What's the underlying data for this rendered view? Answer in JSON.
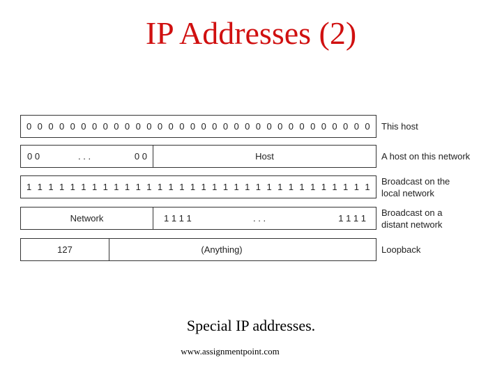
{
  "title": "IP Addresses (2)",
  "rows": [
    {
      "kind": "bits",
      "bits": [
        "0",
        "0",
        "0",
        "0",
        "0",
        "0",
        "0",
        "0",
        "0",
        "0",
        "0",
        "0",
        "0",
        "0",
        "0",
        "0",
        "0",
        "0",
        "0",
        "0",
        "0",
        "0",
        "0",
        "0",
        "0",
        "0",
        "0",
        "0",
        "0",
        "0",
        "0",
        "0"
      ],
      "description": "This host"
    },
    {
      "kind": "split",
      "left": {
        "start": "0 0",
        "ellipsis": ". . .",
        "end": "0 0"
      },
      "right": {
        "label": "Host"
      },
      "description": "A host on this network"
    },
    {
      "kind": "bits",
      "bits": [
        "1",
        "1",
        "1",
        "1",
        "1",
        "1",
        "1",
        "1",
        "1",
        "1",
        "1",
        "1",
        "1",
        "1",
        "1",
        "1",
        "1",
        "1",
        "1",
        "1",
        "1",
        "1",
        "1",
        "1",
        "1",
        "1",
        "1",
        "1",
        "1",
        "1",
        "1",
        "1"
      ],
      "description": "Broadcast on the local network"
    },
    {
      "kind": "split",
      "left": {
        "label": "Network"
      },
      "right": {
        "start": "1 1 1 1",
        "ellipsis": ". . .",
        "end": "1 1 1 1"
      },
      "description": "Broadcast on a distant network"
    },
    {
      "kind": "split",
      "left": {
        "label": "127"
      },
      "right": {
        "label": "(Anything)"
      },
      "description": "Loopback"
    }
  ],
  "descriptions_multiline": {
    "row3": [
      "Broadcast on the",
      "local network"
    ],
    "row4": [
      "Broadcast on a",
      "distant network"
    ]
  },
  "caption": "Special IP addresses.",
  "source": "www.assignmentpoint.com",
  "colors": {
    "title": "#d01010",
    "border": "#333333",
    "text": "#222222"
  }
}
